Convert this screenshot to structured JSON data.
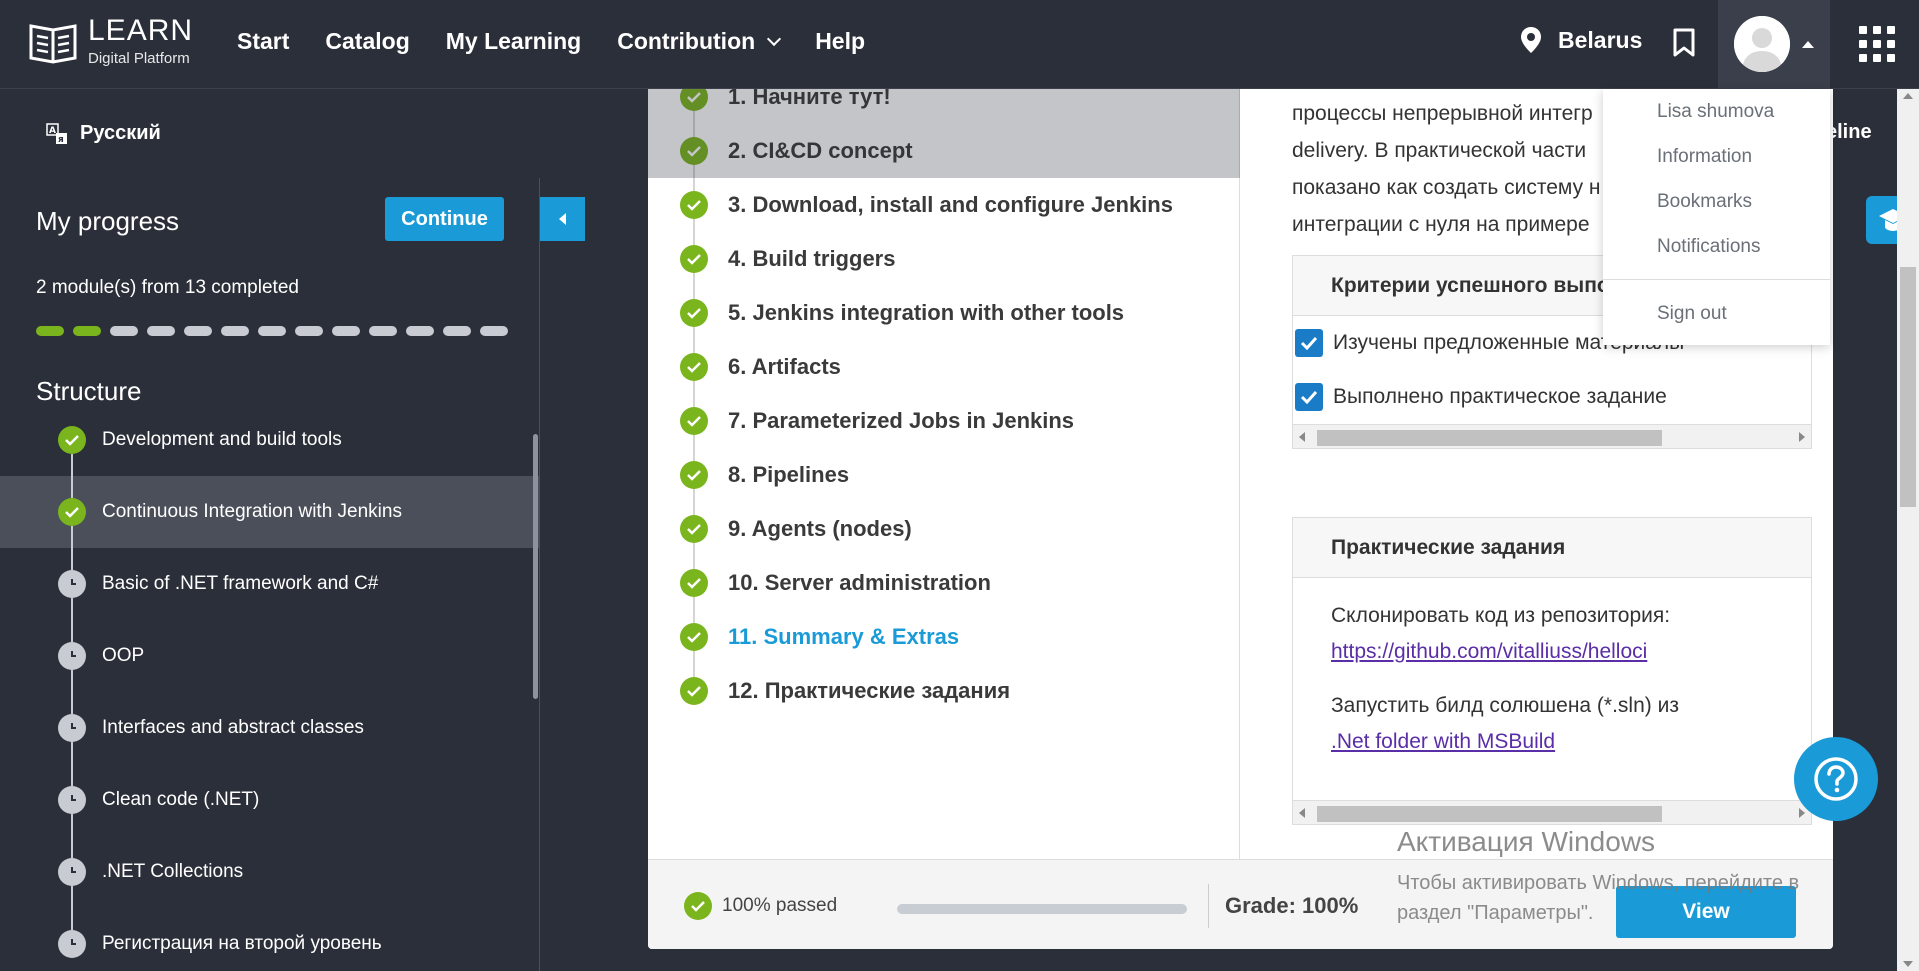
{
  "header": {
    "logo_title": "LEARN",
    "logo_subtitle": "Digital Platform",
    "nav": [
      "Start",
      "Catalog",
      "My Learning",
      "Contribution",
      "Help"
    ],
    "location": "Belarus"
  },
  "langbar": {
    "language": "Русский",
    "pipeline_fragment": "eline"
  },
  "sidebar": {
    "title": "My progress",
    "continue_label": "Continue",
    "completed_text": "2 module(s) from 13 completed",
    "progress_total": 13,
    "progress_done": 2,
    "structure_title": "Structure",
    "modules": [
      {
        "label": "Development and build tools",
        "status": "done"
      },
      {
        "label": "Continuous Integration with Jenkins",
        "status": "done"
      },
      {
        "label": "Basic of .NET framework and C#",
        "status": "pending"
      },
      {
        "label": "OOP",
        "status": "pending"
      },
      {
        "label": "Interfaces and abstract classes",
        "status": "pending"
      },
      {
        "label": "Clean code (.NET)",
        "status": "pending"
      },
      {
        "label": ".NET Collections",
        "status": "pending"
      },
      {
        "label": "Регистрация на второй уровень",
        "status": "pending"
      }
    ]
  },
  "toc": {
    "items": [
      "1. Начните тут!",
      "2. CI&CD concept",
      "3. Download, install and configure Jenkins",
      "4. Build triggers",
      "5. Jenkins integration with other tools",
      "6. Artifacts",
      "7. Parameterized Jobs in Jenkins",
      "8. Pipelines",
      "9. Agents (nodes)",
      "10. Server administration",
      "11. Summary & Extras",
      "12. Практические задания"
    ],
    "current_index": 10
  },
  "content": {
    "desc_lines": [
      "процессы непрерывной интегр",
      "delivery. В практической части",
      "показано как создать систему н",
      "интеграции с нуля на примере"
    ],
    "criteria_title": "Критерии успешного выпо",
    "criteria": [
      "Изучены предложенные материалы",
      "Выполнено практическое задание"
    ],
    "tasks_title": "Практические задания",
    "task_line1": "Склонировать код из репозитория:",
    "task_link1": "https://github.com/vitalliuss/helloci",
    "task_line2": "Запустить билд солюшена (*.sln) из",
    "task_link2": ".Net folder with MSBuild"
  },
  "footer": {
    "passed_text": "100% passed",
    "progress_fraction": 1.0,
    "grade_text": "Grade: 100%",
    "view_label": "View"
  },
  "dropdown": {
    "user": "Lisa shumova",
    "items": [
      "Information",
      "Bookmarks",
      "Notifications"
    ],
    "signout": "Sign out"
  },
  "watermark": {
    "title": "Активация Windows",
    "line1": "Чтобы активировать Windows, перейдите в",
    "line2": "раздел \"Параметры\"."
  },
  "colors": {
    "accent": "#1a9bd7",
    "success": "#7ab51d",
    "dark": "#2b2f39"
  }
}
